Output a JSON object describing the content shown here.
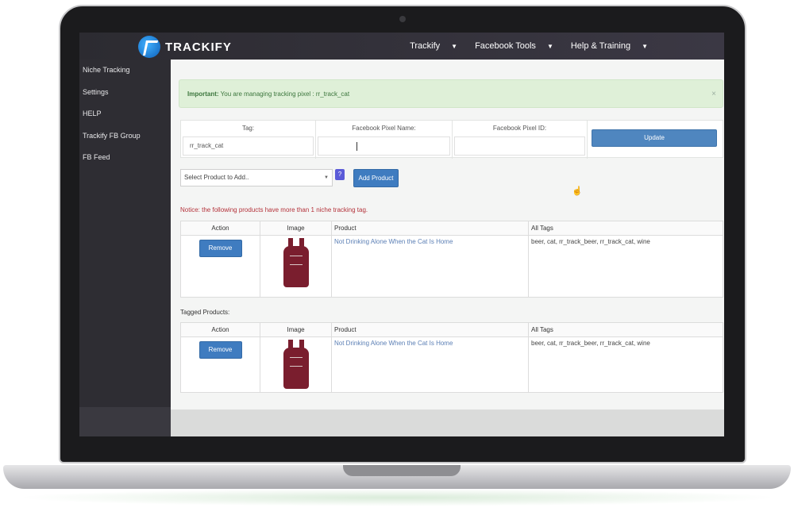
{
  "app": {
    "brand": "TRACKIFY"
  },
  "topnav": {
    "items": [
      {
        "label": "Trackify"
      },
      {
        "label": "Facebook Tools"
      },
      {
        "label": "Help & Training"
      }
    ]
  },
  "sidebar": {
    "items": [
      {
        "label": "Niche Tracking"
      },
      {
        "label": "Settings"
      },
      {
        "label": "HELP"
      },
      {
        "label": "Trackify FB Group"
      },
      {
        "label": "FB Feed"
      }
    ]
  },
  "alert": {
    "strong": "Important:",
    "text": " You are managing tracking pixel : rr_track_cat",
    "close": "×"
  },
  "pixel_form": {
    "tag_label": "Tag:",
    "tag_value": "rr_track_cat",
    "pixel_name_label": "Facebook Pixel Name:",
    "pixel_name_value": "",
    "pixel_id_label": "Facebook Pixel ID:",
    "pixel_id_value": "",
    "update_label": "Update"
  },
  "add_product": {
    "select_value": "Select Product to Add..",
    "help": "?",
    "button": "Add Product"
  },
  "notice": "Notice: the following products have more than 1 niche tracking tag.",
  "tables": {
    "headers": {
      "action": "Action",
      "image": "Image",
      "product": "Product",
      "tags": "All Tags"
    },
    "remove_label": "Remove",
    "multi_tag_products": [
      {
        "product": "Not Drinking Alone When the Cat Is Home",
        "tags": "beer, cat, rr_track_beer, rr_track_cat, wine"
      }
    ],
    "tagged_label": "Tagged Products:",
    "tagged_products": [
      {
        "product": "Not Drinking Alone When the Cat Is Home",
        "tags": "beer, cat, rr_track_beer, rr_track_cat, wine"
      }
    ]
  },
  "colors": {
    "nav_bg": "#2c2b31",
    "primary_button": "#3f7cc0",
    "alert_bg": "#dff0d8",
    "notice_text": "#b4323a"
  }
}
